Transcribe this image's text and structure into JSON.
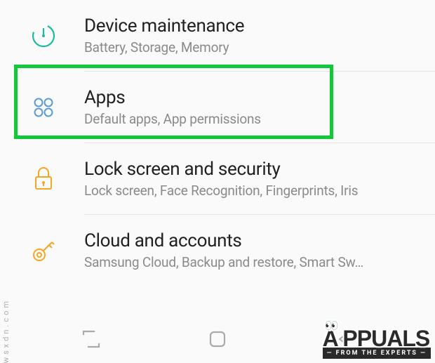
{
  "settings": [
    {
      "id": "device-maintenance",
      "title": "Device maintenance",
      "subtitle": "Battery, Storage, Memory",
      "icon": "gauge-icon",
      "color": "#1abc9c"
    },
    {
      "id": "apps",
      "title": "Apps",
      "subtitle": "Default apps, App permissions",
      "icon": "apps-icon",
      "color": "#5b9bd5",
      "highlighted": true
    },
    {
      "id": "lock-screen-security",
      "title": "Lock screen and security",
      "subtitle": "Lock screen, Face Recognition, Fingerprints, Iris",
      "icon": "lock-icon",
      "color": "#f5a623"
    },
    {
      "id": "cloud-accounts",
      "title": "Cloud and accounts",
      "subtitle": "Samsung Cloud, Backup and restore, Smart Sw…",
      "icon": "key-icon",
      "color": "#f5a623"
    }
  ],
  "watermark": {
    "brand_a": "A",
    "brand_rest": "PPUALS",
    "tagline": "— FROM THE EXPERTS —",
    "url": "wsxdn.com"
  }
}
